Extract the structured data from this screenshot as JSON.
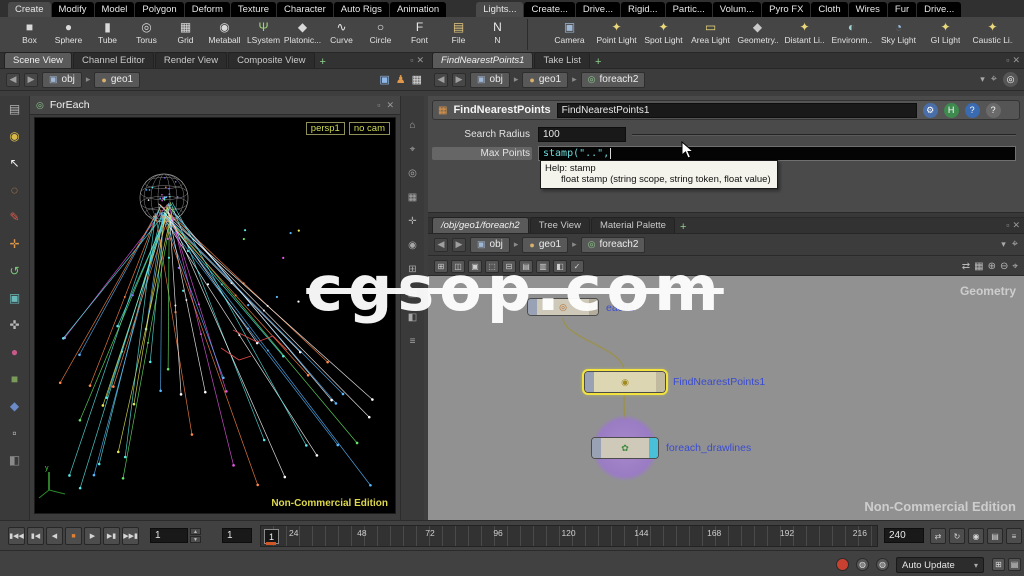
{
  "watermark_text": "cgsop.com",
  "colors": {
    "edition_yellow": "#ddd84e",
    "code_cyan": "#6fd9d9",
    "node_label_blue": "#3a4cd0",
    "selection_yellow": "#f2e43c",
    "network_bg": "#919191"
  },
  "menubar": {
    "left_tabs": [
      "Create",
      "Modify",
      "Model",
      "Polygon",
      "Deform",
      "Texture",
      "Character",
      "Auto Rigs",
      "Animation"
    ],
    "right_tabs": [
      "Lights...",
      "Create...",
      "Drive...",
      "Rigid...",
      "Partic...",
      "Volum...",
      "Pyro FX",
      "Cloth",
      "Wires",
      "Fur",
      "Drive..."
    ]
  },
  "shelf": {
    "left_tools": [
      {
        "label": "Box",
        "glyph": "■",
        "color": "#d9d9d9"
      },
      {
        "label": "Sphere",
        "glyph": "●",
        "color": "#d9d9d9"
      },
      {
        "label": "Tube",
        "glyph": "▮",
        "color": "#d9d9d9"
      },
      {
        "label": "Torus",
        "glyph": "◎",
        "color": "#d9d9d9"
      },
      {
        "label": "Grid",
        "glyph": "▦",
        "color": "#d9d9d9"
      },
      {
        "label": "Metaball",
        "glyph": "◉",
        "color": "#d9d9d9"
      },
      {
        "label": "LSystem",
        "glyph": "Ψ",
        "color": "#9fd37a"
      },
      {
        "label": "Platonic...",
        "glyph": "◆",
        "color": "#d9d9d9"
      },
      {
        "label": "Curve",
        "glyph": "∿",
        "color": "#e8e8e8"
      },
      {
        "label": "Circle",
        "glyph": "○",
        "color": "#e8e8e8"
      },
      {
        "label": "Font",
        "glyph": "F",
        "color": "#e8e8e8"
      },
      {
        "label": "File",
        "glyph": "▤",
        "color": "#e3c77d"
      },
      {
        "label": "N",
        "glyph": "N",
        "color": "#e8e8e8"
      }
    ],
    "right_tools": [
      {
        "label": "Camera",
        "glyph": "▣",
        "color": "#9fb6d4"
      },
      {
        "label": "Point Light",
        "glyph": "✦",
        "color": "#e8d87a"
      },
      {
        "label": "Spot Light",
        "glyph": "✦",
        "color": "#e8d87a"
      },
      {
        "label": "Area Light",
        "glyph": "▭",
        "color": "#e8d87a"
      },
      {
        "label": "Geometry...",
        "glyph": "◆",
        "color": "#c9c9c9"
      },
      {
        "label": "Distant Li...",
        "glyph": "✦",
        "color": "#e8d87a"
      },
      {
        "label": "Environm...",
        "glyph": "◐",
        "color": "#9fd3d3"
      },
      {
        "label": "Sky Light",
        "glyph": "◔",
        "color": "#9fc3e8"
      },
      {
        "label": "GI Light",
        "glyph": "✦",
        "color": "#e8d87a"
      },
      {
        "label": "Caustic Li...",
        "glyph": "✦",
        "color": "#e8d87a"
      }
    ]
  },
  "left_pane": {
    "tabs": [
      "Scene View",
      "Channel Editor",
      "Render View",
      "Composite View"
    ],
    "new_tab_label": "+",
    "path": [
      "obj",
      "geo1"
    ],
    "viewport": {
      "title": "ForEach",
      "camera_chip": "persp1",
      "cam_menu_chip": "no cam",
      "edition": "Non-Commercial Edition",
      "line_colors": [
        "#58b8ff",
        "#58e8e8",
        "#58b8ff",
        "#68e868",
        "#e8e858",
        "#e858e8",
        "#ffffff",
        "#58e8e8",
        "#8878ff",
        "#ff8848"
      ]
    }
  },
  "left_toolbar_icons": [
    {
      "name": "pane-layout-icon",
      "glyph": "▤",
      "color": "#b8b8b8"
    },
    {
      "name": "view-tool-icon",
      "glyph": "◉",
      "color": "#d8b84a"
    },
    {
      "name": "select-tool-icon",
      "glyph": "↖",
      "color": "#f0f0f0"
    },
    {
      "name": "lasso-tool-icon",
      "glyph": "◌",
      "color": "#e09a50"
    },
    {
      "name": "paint-tool-icon",
      "glyph": "✎",
      "color": "#d85a4a"
    },
    {
      "name": "move-tool-icon",
      "glyph": "✛",
      "color": "#e0984a"
    },
    {
      "name": "rotate-tool-icon",
      "glyph": "↺",
      "color": "#7ac87a"
    },
    {
      "name": "scale-tool-icon",
      "glyph": "▣",
      "color": "#6ab8b8"
    },
    {
      "name": "pose-tool-icon",
      "glyph": "✜",
      "color": "#b8b8b8"
    },
    {
      "name": "sculpt-tool-icon",
      "glyph": "●",
      "color": "#c85a8a"
    },
    {
      "name": "blend-tool-icon",
      "glyph": "■",
      "color": "#7a9a5a"
    },
    {
      "name": "wire-tool-icon",
      "glyph": "◆",
      "color": "#6a8ac8"
    },
    {
      "name": "shatter-tool-icon",
      "glyph": "▫",
      "color": "#c8c8c8"
    },
    {
      "name": "misc-tool-icon",
      "glyph": "◧",
      "color": "#8a8a8a"
    }
  ],
  "vp_right_strip_icons": [
    {
      "name": "home-view-icon",
      "glyph": "⌂"
    },
    {
      "name": "frame-view-icon",
      "glyph": "⌖"
    },
    {
      "name": "camera-list-icon",
      "glyph": "◎"
    },
    {
      "name": "grid-toggle-icon",
      "glyph": "▦"
    },
    {
      "name": "snap-icon",
      "glyph": "✛"
    },
    {
      "name": "shade-mode-icon",
      "glyph": "◉"
    },
    {
      "name": "wireframe-icon",
      "glyph": "⊞"
    },
    {
      "name": "display-options-icon",
      "glyph": "▤"
    },
    {
      "name": "pane-split-icon",
      "glyph": "◧"
    },
    {
      "name": "view-menu-icon",
      "glyph": "≡"
    }
  ],
  "right_top_pane": {
    "tabs": [
      "FindNearestPoints1",
      "Take List"
    ],
    "new_tab_label": "+",
    "path": [
      "obj",
      "geo1",
      "foreach2"
    ],
    "node_type_label": "FindNearestPoints",
    "node_name": "FindNearestPoints1",
    "params": {
      "search_radius_label": "Search Radius",
      "search_radius_value": "100",
      "max_points_label": "Max Points",
      "max_points_value": "stamp(\"..\", "
    },
    "tooltip": {
      "title": "Help: stamp",
      "body": "float stamp (string scope, string token, float value)"
    }
  },
  "network_pane": {
    "tabs": [
      "/obj/geo1/foreach2",
      "Tree View",
      "Material Palette"
    ],
    "new_tab_label": "+",
    "path": [
      "obj",
      "geo1",
      "foreach2"
    ],
    "nodes": {
      "each": {
        "name": "each1"
      },
      "findnearest": {
        "name": "FindNearestPoints1"
      },
      "foreach": {
        "name": "foreach_drawlines"
      }
    },
    "context_label": "Geometry",
    "edition": "Non-Commercial Edition"
  },
  "playbar": {
    "transport": [
      {
        "name": "jump-start-button",
        "glyph": "▮◀◀",
        "color": "#d6d6d6"
      },
      {
        "name": "prev-frame-button",
        "glyph": "▮◀",
        "color": "#d6d6d6"
      },
      {
        "name": "play-reverse-button",
        "glyph": "◀",
        "color": "#d6d6d6"
      },
      {
        "name": "stop-button",
        "glyph": "■",
        "color": "#e08030"
      },
      {
        "name": "play-button",
        "glyph": "▶",
        "color": "#d6d6d6"
      },
      {
        "name": "next-frame-button",
        "glyph": "▶▮",
        "color": "#d6d6d6"
      },
      {
        "name": "jump-end-button",
        "glyph": "▶▶▮",
        "color": "#d6d6d6"
      }
    ],
    "frame_current": "1",
    "frame_increment": "1",
    "frame_marker": "1",
    "frame_end": "240",
    "ticks": [
      "24",
      "48",
      "72",
      "96",
      "120",
      "144",
      "168",
      "192",
      "216"
    ],
    "right_icons": [
      {
        "name": "playback-range-icon",
        "glyph": "⇄"
      },
      {
        "name": "loop-mode-icon",
        "glyph": "↻"
      },
      {
        "name": "realtime-toggle-icon",
        "glyph": "◉"
      },
      {
        "name": "dopesheet-icon",
        "glyph": "▤"
      },
      {
        "name": "playbar-menu-icon",
        "glyph": "≡"
      }
    ]
  },
  "statusbar": {
    "update_mode": "Auto Update",
    "dropdown_glyph": "▾"
  },
  "misc_glyphs": {
    "back": "◀",
    "fwd": "▶",
    "sep": "▸",
    "dropdown": "▾",
    "pin": "⌖",
    "close": "✕",
    "float": "▫",
    "plus": "+",
    "gear": "⚙",
    "help_h": "H",
    "help_q": "?",
    "info_q": "?",
    "obj_icon": "▣",
    "geo_icon": "●",
    "foreach_icon": "◎",
    "cube_icon": "▣",
    "person_icon": "♟",
    "grid_icon": "▦",
    "net_toolbar": [
      "⊞",
      "◫",
      "▣",
      "⬚",
      "⊟",
      "▤",
      "▥",
      "◧",
      "✓"
    ],
    "net_right": [
      "⇄",
      "▦",
      "⊕",
      "⊖",
      "⌖"
    ]
  }
}
